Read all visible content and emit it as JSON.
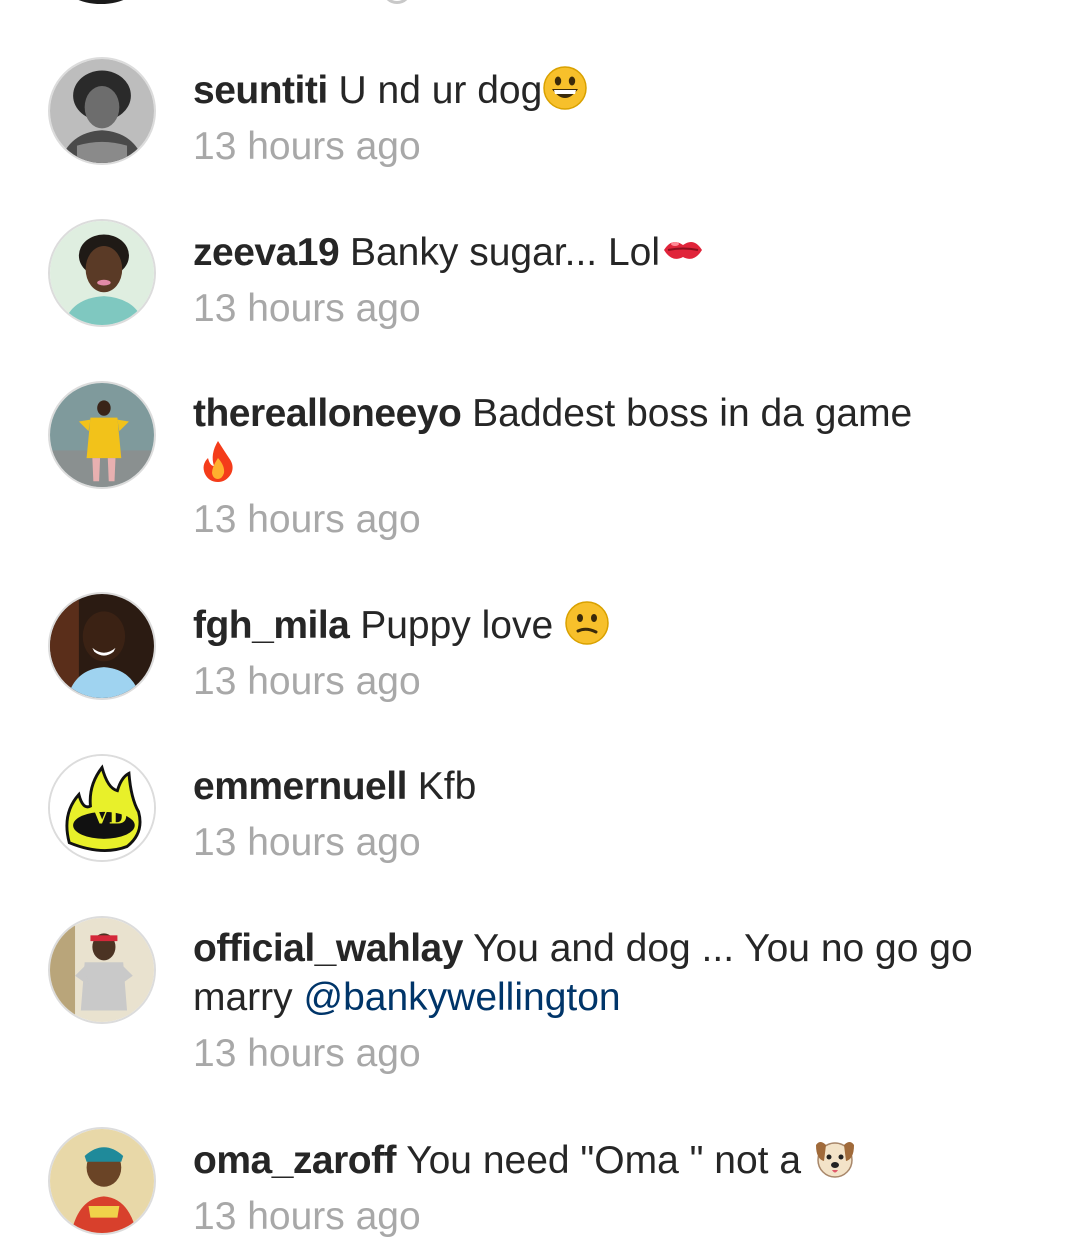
{
  "comments": [
    {
      "username": "seuntiti",
      "text": "U nd ur dog",
      "emoji": "grinning-face-emoji",
      "time": "13 hours ago",
      "avatar": "user-avatar-seuntiti"
    },
    {
      "username": "zeeva19",
      "text": "Banky sugar... Lol",
      "emoji": "kiss-lips-emoji",
      "time": "13 hours ago",
      "avatar": "user-avatar-zeeva19"
    },
    {
      "username": "therealloneeyo",
      "text": "Baddest boss in da game",
      "emoji": "fire-emoji",
      "time": "13 hours ago",
      "avatar": "user-avatar-therealloneeyo"
    },
    {
      "username": "fgh_mila",
      "text": "Puppy love ",
      "emoji": "confused-face-emoji",
      "time": "13 hours ago",
      "avatar": "user-avatar-fgh_mila"
    },
    {
      "username": "emmernuell",
      "text": "Kfb",
      "time": "13 hours ago",
      "avatar": "user-avatar-emmernuell"
    },
    {
      "username": "official_wahlay",
      "text": "You and dog ... You no go go marry ",
      "mention": "@bankywellington",
      "time": "13 hours ago",
      "avatar": "user-avatar-official_wahlay"
    },
    {
      "username": "oma_zaroff",
      "text": "You need \"Oma \" not a ",
      "emoji": "dog-face-emoji",
      "time": "13 hours ago",
      "avatar": "user-avatar-oma_zaroff"
    }
  ],
  "colors": {
    "username": "#262626",
    "text": "#262626",
    "time": "#a8a8a8",
    "mention": "#003569",
    "background": "#ffffff"
  }
}
